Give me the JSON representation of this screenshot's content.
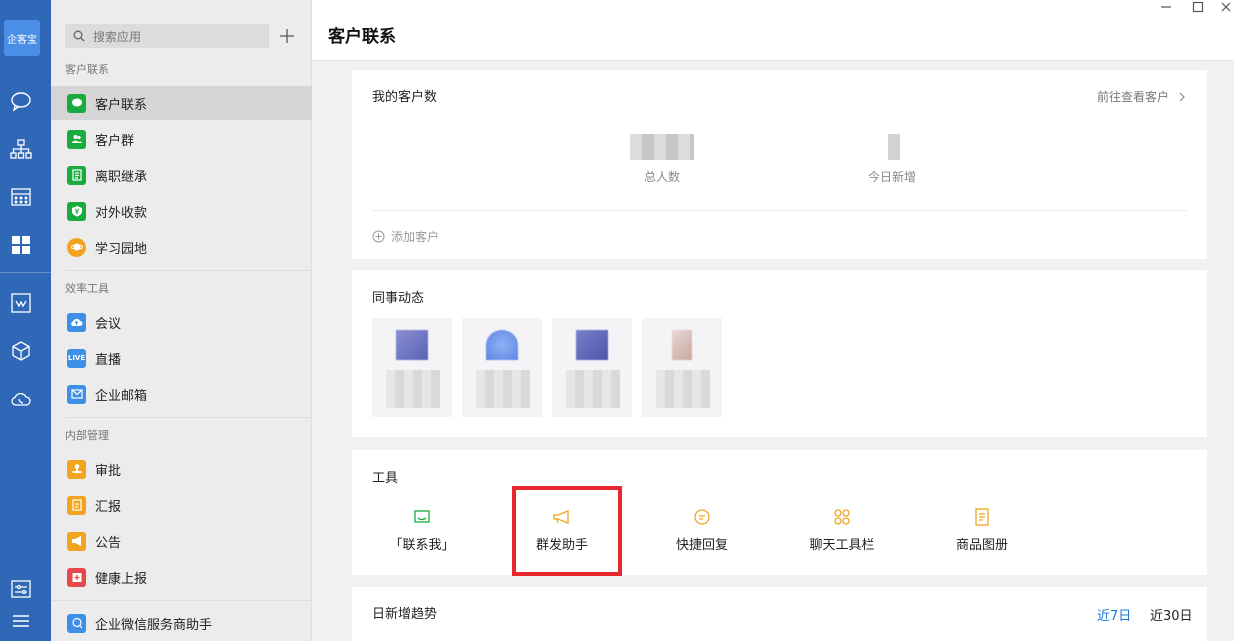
{
  "rail": {
    "logo": "企客宝"
  },
  "apps": {
    "search_placeholder": "搜索应用",
    "sections": [
      {
        "label": "客户联系",
        "items": [
          "客户联系",
          "客户群",
          "离职继承",
          "对外收款",
          "学习园地"
        ]
      },
      {
        "label": "效率工具",
        "items": [
          "会议",
          "直播",
          "企业邮箱"
        ]
      },
      {
        "label": "内部管理",
        "items": [
          "审批",
          "汇报",
          "公告",
          "健康上报"
        ]
      }
    ],
    "footer_item": "企业微信服务商助手",
    "live_badge": "LIVE"
  },
  "main": {
    "title": "客户联系",
    "customers": {
      "title": "我的客户数",
      "link": "前往查看客户",
      "total_label": "总人数",
      "today_label": "今日新增",
      "add_label": "添加客户"
    },
    "colleagues": {
      "title": "同事动态"
    },
    "tools": {
      "title": "工具",
      "items": [
        "「联系我」",
        "群发助手",
        "快捷回复",
        "聊天工具栏",
        "商品图册"
      ]
    },
    "trend": {
      "title": "日新增趋势",
      "range_7": "近7日",
      "range_30": "近30日"
    }
  },
  "colors": {
    "rail": "#2f68b6",
    "accent": "#1a78d4",
    "highlight": "#e8282f",
    "tool_icon": "#f2a41f",
    "green": "#1aab3f"
  }
}
